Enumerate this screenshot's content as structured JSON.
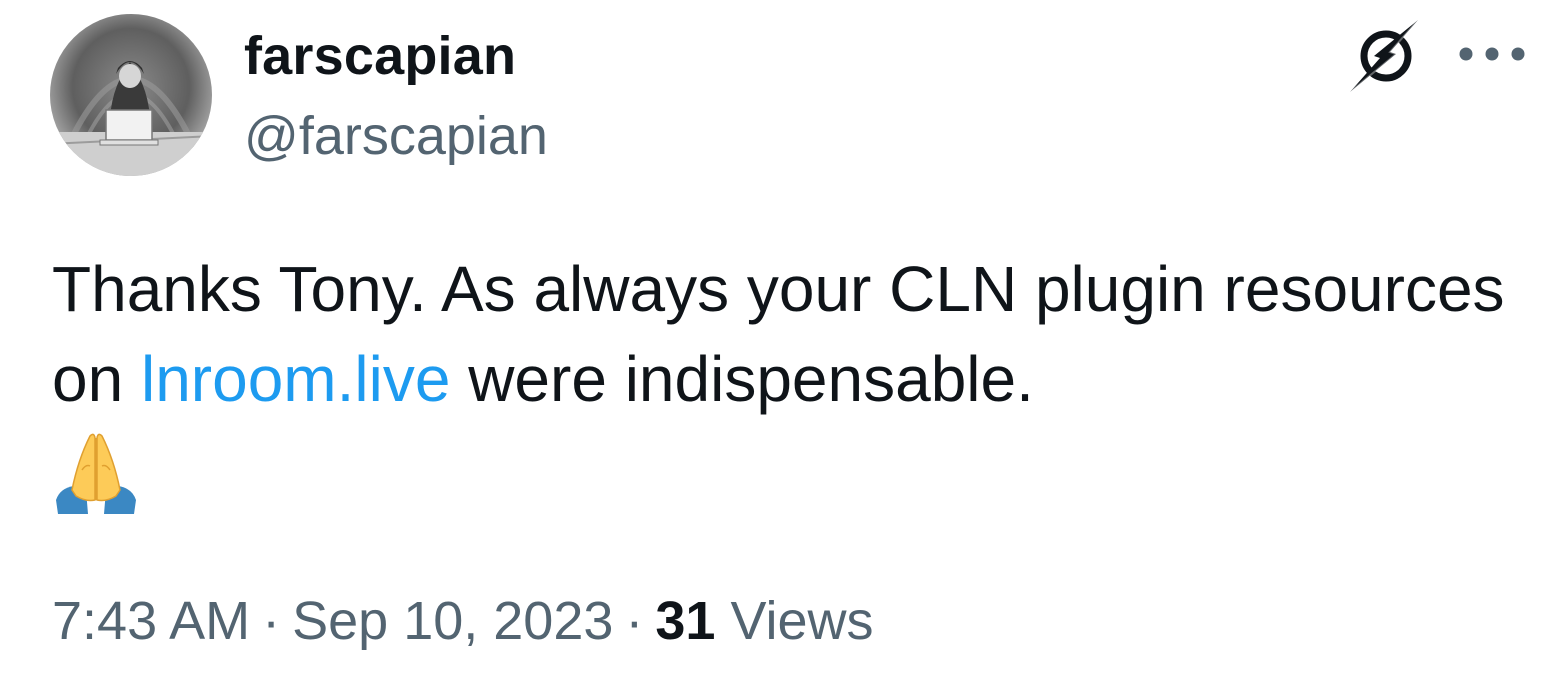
{
  "author": {
    "display_name": "farscapian",
    "handle": "@farscapian",
    "avatar_icon": "hooded-figure-laptop-avatar",
    "badge_icon": "lightning-slash-icon"
  },
  "tweet": {
    "text_before_link": "Thanks Tony. As always your CLN plugin resources on ",
    "link_text": "lnroom.live",
    "text_after_link": " were indispensable.",
    "emoji": "folded-hands-emoji"
  },
  "meta": {
    "time": "7:43 AM",
    "separator": "·",
    "date": "Sep 10, 2023",
    "views_count": "31",
    "views_label": "Views"
  },
  "colors": {
    "text": "#0f1419",
    "secondary": "#536471",
    "link": "#1d9bf0"
  }
}
